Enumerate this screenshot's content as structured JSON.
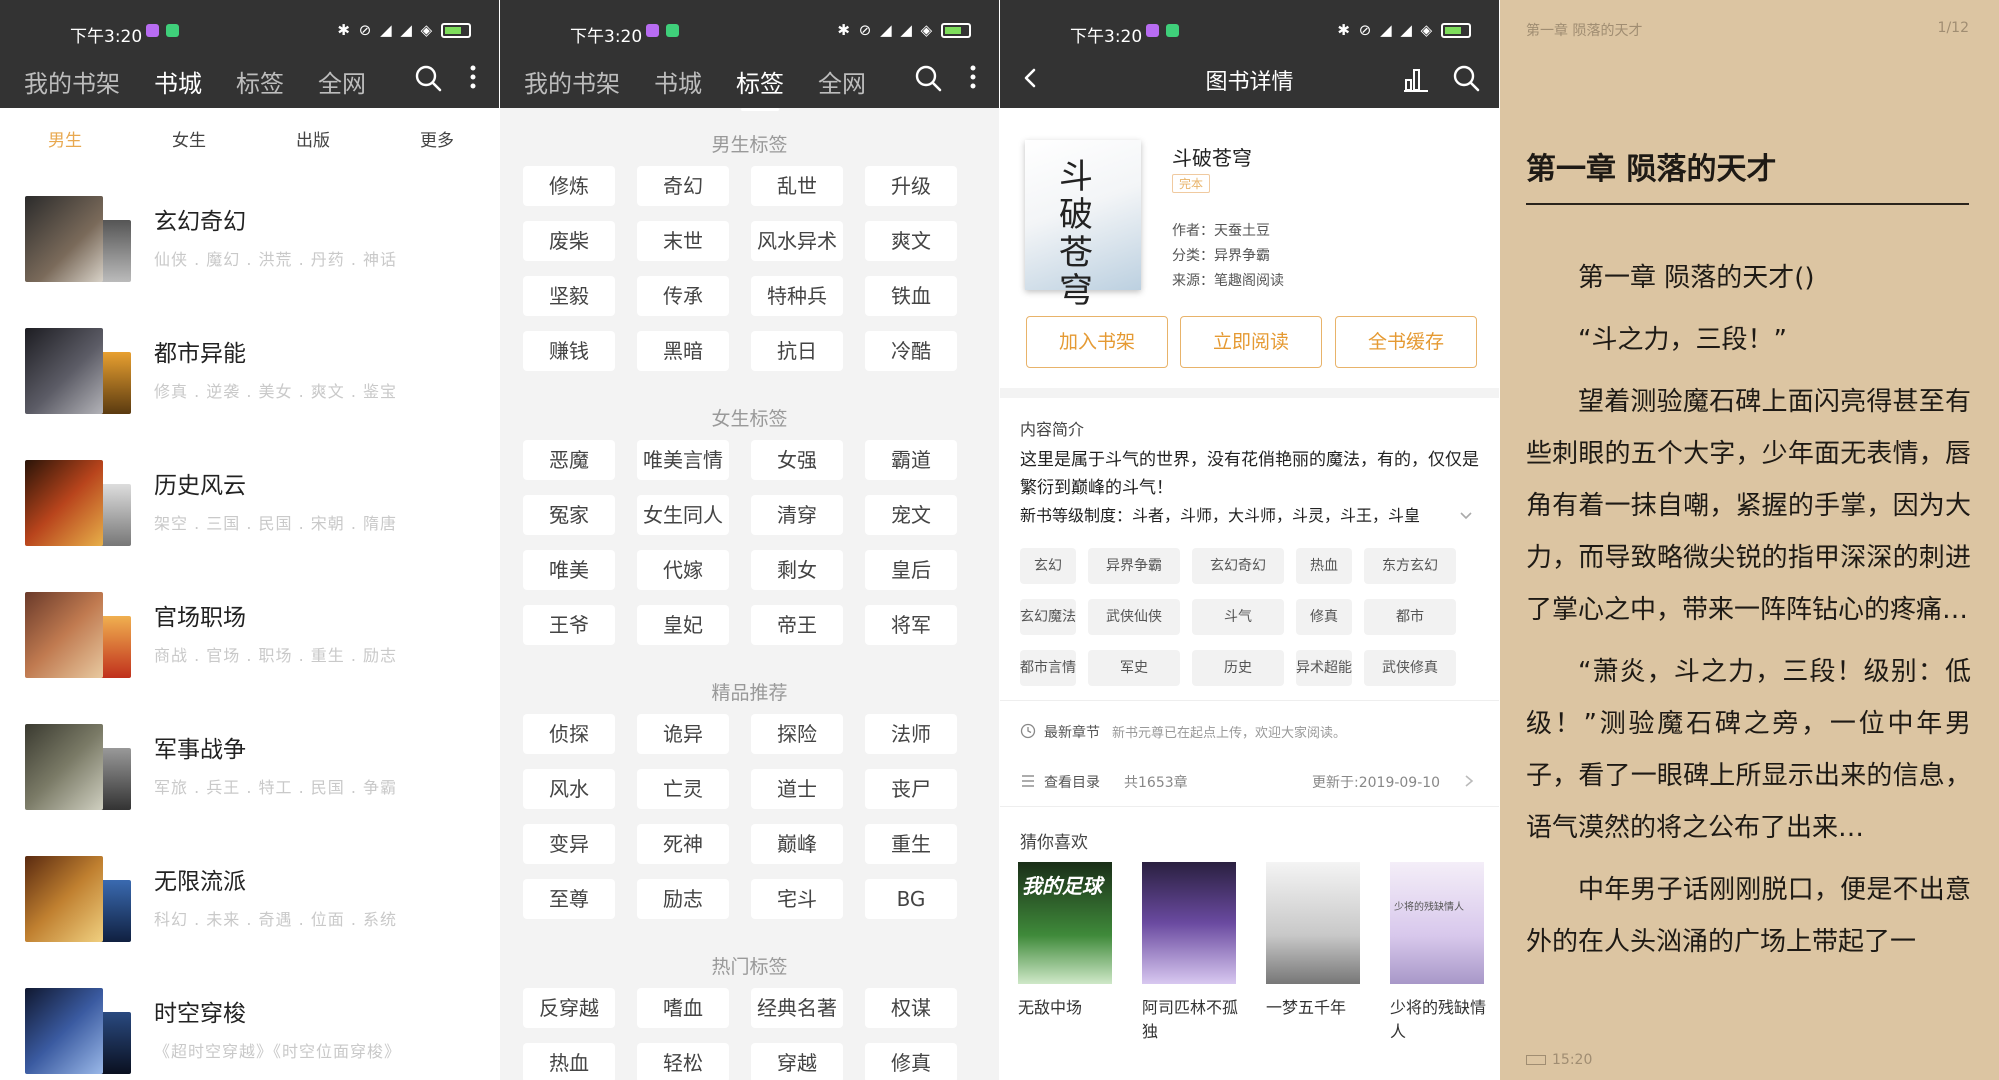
{
  "status": {
    "time": "下午3:20"
  },
  "s1": {
    "tabs": [
      "我的书架",
      "书城",
      "标签",
      "全网"
    ],
    "active_tab": 1,
    "subtabs": [
      "男生",
      "女生",
      "出版",
      "更多"
    ],
    "active_subtab": 0,
    "categories": [
      {
        "title": "玄幻奇幻",
        "tags": "仙侠 . 魔幻 . 洪荒 . 丹药 . 神话"
      },
      {
        "title": "都市异能",
        "tags": "修真 . 逆袭 . 美女 . 爽文 . 鉴宝"
      },
      {
        "title": "历史风云",
        "tags": "架空 . 三国 . 民国 . 宋朝 . 隋唐"
      },
      {
        "title": "官场职场",
        "tags": "商战 . 官场 . 职场 . 重生 . 励志"
      },
      {
        "title": "军事战争",
        "tags": "军旅 . 兵王 . 特工 . 民国 . 争霸"
      },
      {
        "title": "无限流派",
        "tags": "科幻 . 未来 . 奇遇 . 位面 . 系统"
      },
      {
        "title": "时空穿梭",
        "tags": "《超时空穿越》《时空位面穿梭》"
      }
    ]
  },
  "s2": {
    "tabs": [
      "我的书架",
      "书城",
      "标签",
      "全网"
    ],
    "active_tab": 2,
    "sections": [
      {
        "title": "男生标签",
        "tags": [
          "修炼",
          "奇幻",
          "乱世",
          "升级",
          "废柴",
          "末世",
          "风水异术",
          "爽文",
          "坚毅",
          "传承",
          "特种兵",
          "铁血",
          "赚钱",
          "黑暗",
          "抗日",
          "冷酷"
        ]
      },
      {
        "title": "女生标签",
        "tags": [
          "恶魔",
          "唯美言情",
          "女强",
          "霸道",
          "冤家",
          "女生同人",
          "清穿",
          "宠文",
          "唯美",
          "代嫁",
          "剩女",
          "皇后",
          "王爷",
          "皇妃",
          "帝王",
          "将军"
        ]
      },
      {
        "title": "精品推荐",
        "tags": [
          "侦探",
          "诡异",
          "探险",
          "法师",
          "风水",
          "亡灵",
          "道士",
          "丧尸",
          "变异",
          "死神",
          "巅峰",
          "重生",
          "至尊",
          "励志",
          "宅斗",
          "BG"
        ]
      },
      {
        "title": "热门标签",
        "tags": [
          "反穿越",
          "嗜血",
          "经典名著",
          "权谋",
          "热血",
          "轻松",
          "穿越",
          "修真"
        ]
      }
    ]
  },
  "s3": {
    "title": "图书详情",
    "book": {
      "name": "斗破苍穹",
      "badge": "完本",
      "cover_text": "斗破苍穹",
      "author": "作者：天蚕土豆",
      "category": "分类：异界争霸",
      "source": "来源：笔趣阁阅读"
    },
    "buttons": [
      "加入书架",
      "立即阅读",
      "全书缓存"
    ],
    "intro_label": "内容简介",
    "intro": "这里是属于斗气的世界，没有花俏艳丽的魔法，有的，仅仅是繁衍到巅峰的斗气！",
    "intro_more": "新书等级制度：斗者，斗师，大斗师，斗灵，斗王，斗皇",
    "tags": [
      "玄幻",
      "异界争霸",
      "玄幻奇幻",
      "热血",
      "东方玄幻",
      "玄幻魔法",
      "武侠仙侠",
      "斗气",
      "修真",
      "都市",
      "都市言情",
      "军史",
      "历史",
      "异术超能",
      "武侠修真"
    ],
    "latest_label": "最新章节",
    "latest_text": "新书元尊已在起点上传，欢迎大家阅读。",
    "toc_label": "查看目录",
    "toc_count": "共1653章",
    "updated": "更新于:2019-09-10",
    "rec_label": "猜你喜欢",
    "rec_books": [
      {
        "name": "无敌中场",
        "cover_text": "我的足球"
      },
      {
        "name": "阿司匹林不孤独",
        "cover_text": ""
      },
      {
        "name": "一梦五千年",
        "cover_text": ""
      },
      {
        "name": "少将的残缺情人",
        "cover_text": "少将的残缺情人"
      }
    ]
  },
  "s4": {
    "header": "第一章 陨落的天才",
    "page": "1/12",
    "chapter_heading": "第一章 陨落的天才",
    "paragraphs": [
      "第一章 陨落的天才()",
      "“斗之力，三段！”",
      "望着测验魔石碑上面闪亮得甚至有些刺眼的五个大字，少年面无表情，唇角有着一抹自嘲，紧握的手掌，因为大力，而导致略微尖锐的指甲深深的刺进了掌心之中，带来一阵阵钻心的疼痛…",
      "“萧炎，斗之力，三段！级别：低级！”测验魔石碑之旁，一位中年男子，看了一眼碑上所显示出来的信息，语气漠然的将之公布了出来…",
      "中年男子话刚刚脱口，便是不出意外的在人头汹涌的广场上带起了一"
    ],
    "clock": "15:20"
  },
  "colors": {
    "accent": "#e8a84f",
    "header": "#333333",
    "paper": "#dcc5a2"
  }
}
